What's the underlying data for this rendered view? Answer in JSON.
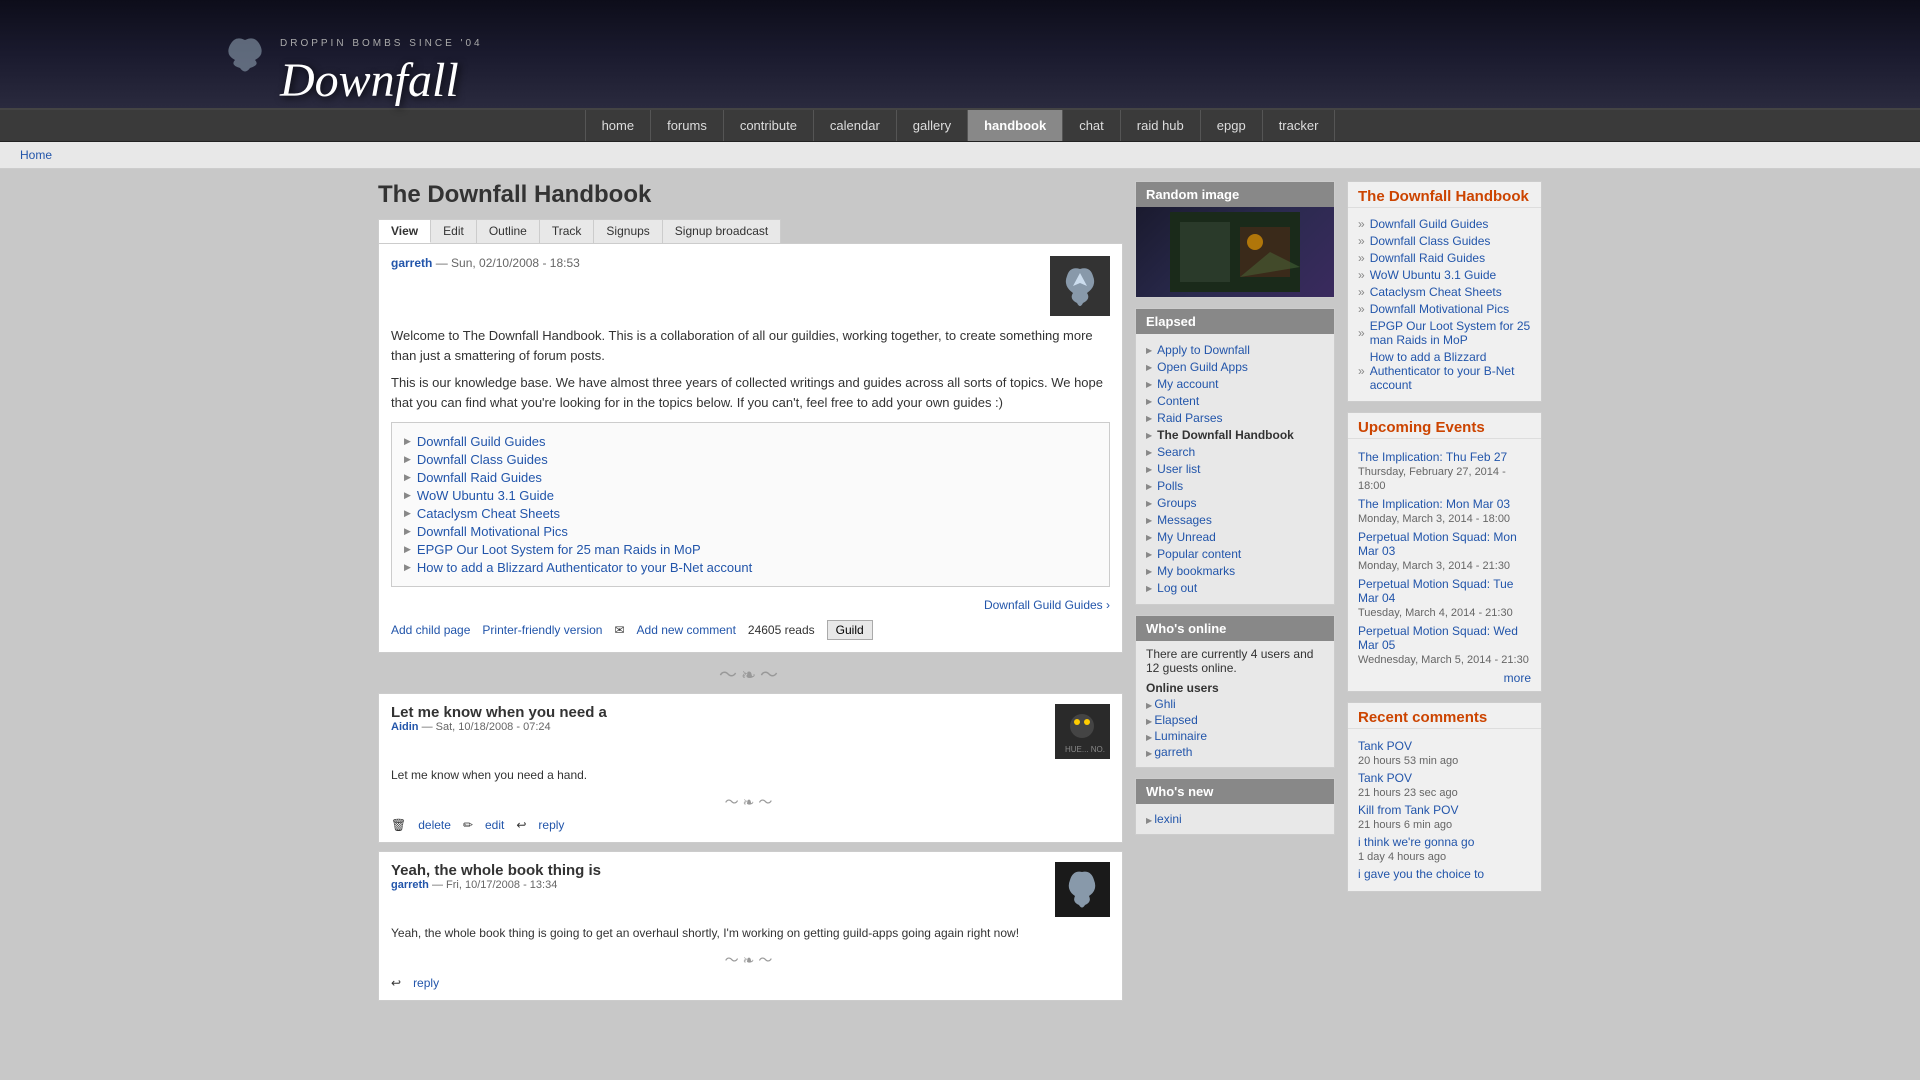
{
  "header": {
    "logo_sub": "DROPPIN BOMBS SINCE '04",
    "logo_text": "Downfall"
  },
  "nav": {
    "items": [
      {
        "label": "home",
        "active": false
      },
      {
        "label": "forums",
        "active": false
      },
      {
        "label": "contribute",
        "active": false
      },
      {
        "label": "calendar",
        "active": false
      },
      {
        "label": "gallery",
        "active": false
      },
      {
        "label": "handbook",
        "active": true
      },
      {
        "label": "chat",
        "active": false
      },
      {
        "label": "raid hub",
        "active": false
      },
      {
        "label": "epgp",
        "active": false
      },
      {
        "label": "tracker",
        "active": false
      }
    ]
  },
  "breadcrumb": {
    "home_label": "Home"
  },
  "page": {
    "title": "The Downfall Handbook",
    "tabs": [
      "View",
      "Edit",
      "Outline",
      "Track",
      "Signups",
      "Signup broadcast"
    ],
    "active_tab": 0,
    "author": "garreth",
    "date": "Sun, 02/10/2008 - 18:53",
    "body_p1": "Welcome to The Downfall Handbook. This is a collaboration of all our guildies, working together, to create something more than just a smattering of forum posts.",
    "body_p2": "This is our knowledge base. We have almost three years of collected writings and guides across all sorts of topics. We hope that you can find what you're looking for in the topics below. If you can't, feel free to add your own guides :)",
    "links": [
      "Downfall Guild Guides",
      "Downfall Class Guides",
      "Downfall Raid Guides",
      "WoW Ubuntu 3.1 Guide",
      "Cataclysm Cheat Sheets",
      "Downfall Motivational Pics",
      "EPGP Our Loot System for 25 man Raids in MoP",
      "How to add a Blizzard Authenticator to your B-Net account"
    ],
    "nav_link": "Downfall Guild Guides ›",
    "add_child": "Add child page",
    "printer_friendly": "Printer-friendly version",
    "add_comment": "Add new comment",
    "reads": "24605 reads",
    "guild_btn": "Guild"
  },
  "comments": [
    {
      "title": "Let me know when you need a",
      "author": "Aidin",
      "date": "Sat, 10/18/2008 - 07:24",
      "body": "Let me know when you need a hand.",
      "actions": [
        "delete",
        "edit",
        "reply"
      ],
      "avatar_text": "owl"
    },
    {
      "title": "Yeah, the whole book thing is",
      "author": "garreth",
      "date": "Fri, 10/17/2008 - 13:34",
      "body": "Yeah, the whole book thing is going to get an overhaul shortly, I'm working on getting guild-apps going again right now!",
      "actions": [
        "reply"
      ],
      "avatar_text": "bird"
    }
  ],
  "sidebar_middle": {
    "random_image_title": "Random image",
    "elapsed_title": "Elapsed",
    "elapsed_links": [
      "Apply to Downfall",
      "Open Guild Apps",
      "My account",
      "Content",
      "Raid Parses",
      "The Downfall Handbook",
      "Search",
      "User list",
      "Polls",
      "Groups",
      "Messages",
      "My Unread",
      "Popular content",
      "My bookmarks",
      "Log out"
    ],
    "elapsed_bold": "The Downfall Handbook",
    "whos_online_title": "Who's online",
    "online_text": "There are currently 4 users and 12 guests online.",
    "online_users_title": "Online users",
    "online_users": [
      "Ghli",
      "Elapsed",
      "Luminaire",
      "garreth"
    ],
    "whos_new_title": "Who's new",
    "new_users": [
      "lexini"
    ]
  },
  "sidebar_right": {
    "handbook_title": "The Downfall Handbook",
    "handbook_links": [
      "Downfall Guild Guides",
      "Downfall Class Guides",
      "Downfall Raid Guides",
      "WoW Ubuntu 3.1 Guide",
      "Cataclysm Cheat Sheets",
      "Downfall Motivational Pics",
      "EPGP Our Loot System for 25 man Raids in MoP",
      "How to add a Blizzard Authenticator to your B-Net account"
    ],
    "events_title": "Upcoming Events",
    "events": [
      {
        "name": "The Implication: Thu Feb 27",
        "date": "Thursday, February 27, 2014 - 18:00"
      },
      {
        "name": "The Implication: Mon Mar 03",
        "date": "Monday, March 3, 2014 - 18:00"
      },
      {
        "name": "Perpetual Motion Squad: Mon Mar 03",
        "date": "Monday, March 3, 2014 - 21:30"
      },
      {
        "name": "Perpetual Motion Squad: Tue Mar 04",
        "date": "Tuesday, March 4, 2014 - 21:30"
      },
      {
        "name": "Perpetual Motion Squad: Wed Mar 05",
        "date": "Wednesday, March 5, 2014 - 21:30"
      }
    ],
    "more_label": "more",
    "comments_title": "Recent comments",
    "comments": [
      {
        "name": "Tank POV",
        "time": "20 hours 53 min ago"
      },
      {
        "name": "Tank POV",
        "time": "21 hours 23 sec ago"
      },
      {
        "name": "Kill from Tank POV",
        "time": "21 hours 6 min ago"
      },
      {
        "name": "i think we're gonna go",
        "time": "1 day 4 hours ago"
      },
      {
        "name": "i gave you the choice to",
        "time": ""
      }
    ]
  }
}
